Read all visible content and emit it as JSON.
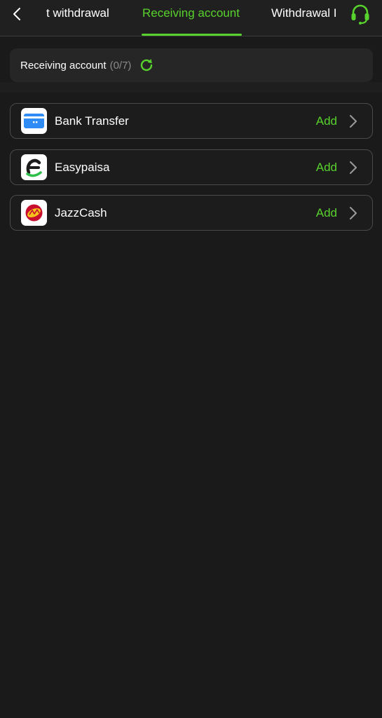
{
  "tabs": [
    {
      "label": "t withdrawal",
      "active": false
    },
    {
      "label": "Receiving account",
      "active": true
    },
    {
      "label": "Withdrawal I",
      "active": false
    }
  ],
  "accent_color": "#58d22c",
  "header": {
    "title": "Receiving account",
    "count": "(0/7)"
  },
  "accounts": [
    {
      "name": "Bank Transfer",
      "action": "Add",
      "icon": "bank-card-icon"
    },
    {
      "name": "Easypaisa",
      "action": "Add",
      "icon": "easypaisa-logo"
    },
    {
      "name": "JazzCash",
      "action": "Add",
      "icon": "jazzcash-logo"
    }
  ]
}
